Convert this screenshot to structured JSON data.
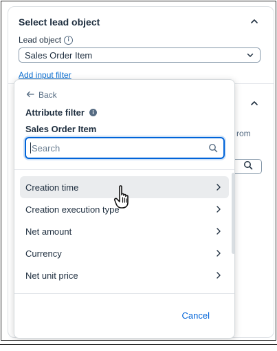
{
  "section": {
    "title": "Select lead object",
    "field_label": "Lead object",
    "field_info_icon": "info-outline-icon",
    "selected_value": "Sales Order Item",
    "add_filter_link": "Add input filter",
    "partial_text": "rom"
  },
  "popover": {
    "back_label": "Back",
    "title": "Attribute filter",
    "title_info_icon": "info-filled-icon",
    "object_name": "Sales Order Item",
    "search_placeholder": "Search",
    "search_value": "",
    "items": [
      {
        "label": "Creation time",
        "hovered": true
      },
      {
        "label": "Creation execution type",
        "hovered": false
      },
      {
        "label": "Net amount",
        "hovered": false
      },
      {
        "label": "Currency",
        "hovered": false
      },
      {
        "label": "Net unit price",
        "hovered": false
      }
    ],
    "cancel_label": "Cancel"
  },
  "colors": {
    "accent": "#0064d9",
    "link": "#0a6ed1",
    "text": "#1d2d3e",
    "hover_bg": "#eaecee"
  }
}
